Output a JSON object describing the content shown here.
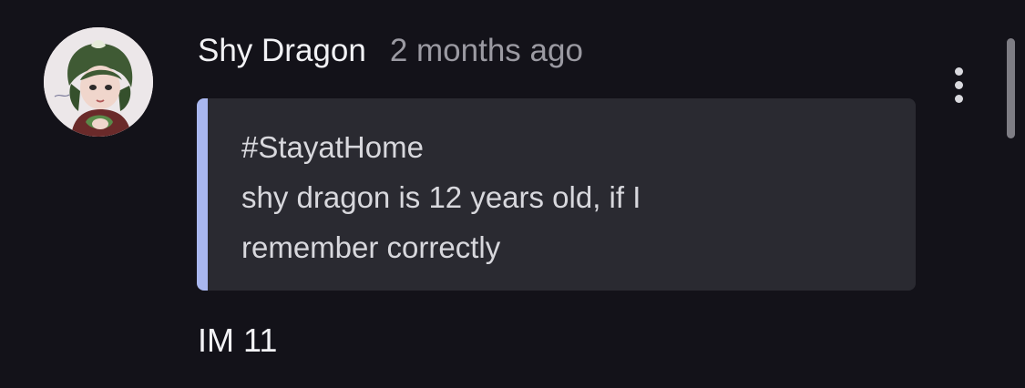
{
  "comment": {
    "author": "Shy Dragon",
    "timestamp": "2 months ago",
    "quote": {
      "lines": [
        "#StayatHome",
        "shy dragon is 12 years old, if I",
        "remember correctly"
      ]
    },
    "body": "IM 11"
  },
  "icons": {
    "avatar": "avatar",
    "more": "more-vertical-icon"
  },
  "colors": {
    "background": "#131219",
    "quote_background": "#2a2a31",
    "quote_accent": "#a9b7ef",
    "author_text": "#f2f2f5",
    "secondary_text": "#9b9aa2"
  }
}
